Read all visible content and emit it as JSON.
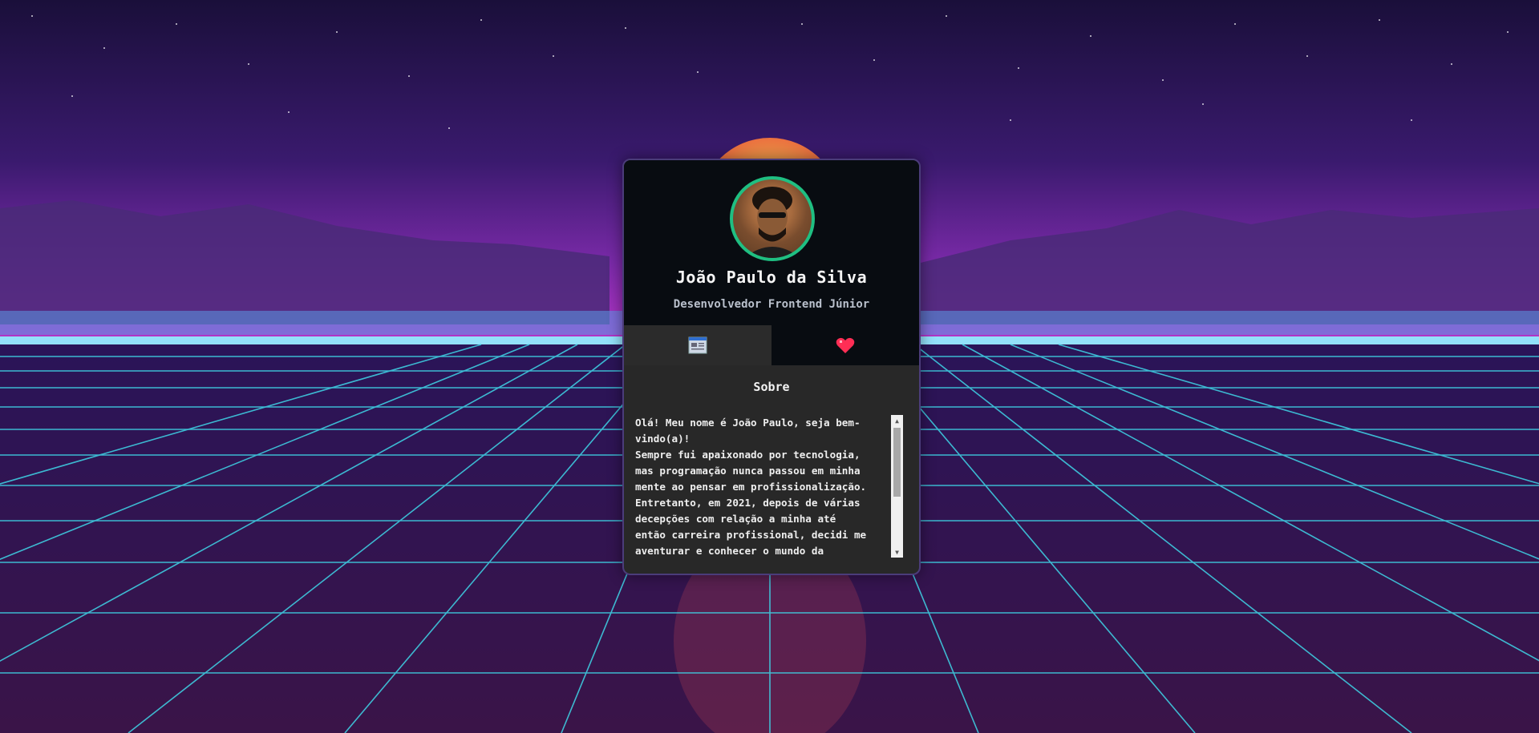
{
  "profile": {
    "name": "João Paulo da Silva",
    "role": "Desenvolvedor Frontend Júnior",
    "avatar_icon": "person-avatar"
  },
  "tabs": [
    {
      "icon": "window-icon",
      "active": true
    },
    {
      "icon": "heart-icon",
      "active": false
    }
  ],
  "section": {
    "title": "Sobre",
    "text": "Olá! Meu nome é João Paulo, seja bem-\nvindo(a)!\nSempre fui apaixonado por tecnologia,\nmas programação nunca passou em minha\nmente ao pensar em profissionalização.\nEntretanto, em 2021, depois de várias\ndecepções com relação a minha até\nentão carreira profissional, decidi me\naventurar e conhecer o mundo da"
  },
  "colors": {
    "accent": "#1fbf82",
    "card_bg": "#282828",
    "header_bg": "#080c11",
    "heart": "#ff2e55",
    "grid": "#3fd6e8"
  }
}
